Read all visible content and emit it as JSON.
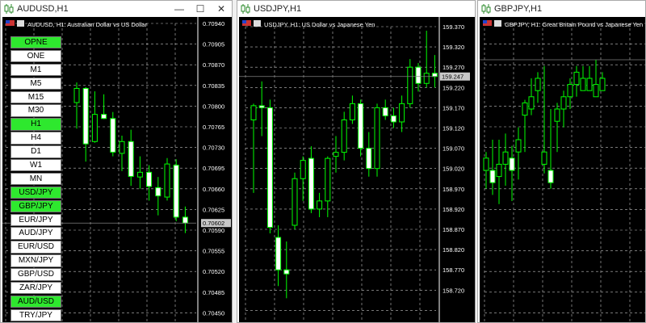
{
  "colors": {
    "grid": "#c0c0c0",
    "candle": "#00ff00",
    "axis_text": "#ffffff",
    "chart_bg": "#000000",
    "active_button": "#2ee82e",
    "price_line": "#808080"
  },
  "windows": [
    {
      "title": "AUDUSD,H1",
      "info": "AUDUSD, H1: Australian Dollar vs US Dollar",
      "controls": {
        "minimize": "—",
        "maximize": "☐",
        "close": "✕"
      },
      "current_price": "0.70602",
      "price_labels": [
        "0.70940",
        "0.70905",
        "0.70870",
        "0.70835",
        "0.70800",
        "0.70765",
        "0.70730",
        "0.70695",
        "0.70660",
        "0.70625",
        "0.70590",
        "0.70555",
        "0.70520",
        "0.70485",
        "0.70450"
      ],
      "buttons": [
        {
          "label": "OPNE",
          "active": true
        },
        {
          "label": "ONE",
          "active": false
        },
        {
          "label": "M1",
          "active": false
        },
        {
          "label": "M5",
          "active": false
        },
        {
          "label": "M15",
          "active": false
        },
        {
          "label": "M30",
          "active": false
        },
        {
          "label": "H1",
          "active": true
        },
        {
          "label": "H4",
          "active": false
        },
        {
          "label": "D1",
          "active": false
        },
        {
          "label": "W1",
          "active": false
        },
        {
          "label": "MN",
          "active": false
        },
        {
          "label": "USD/JPY",
          "active": true
        },
        {
          "label": "GBP/JPY",
          "active": true
        },
        {
          "label": "EUR/JPY",
          "active": false
        },
        {
          "label": "AUD/JPY",
          "active": false
        },
        {
          "label": "EUR/USD",
          "active": false
        },
        {
          "label": "MXN/JPY",
          "active": false
        },
        {
          "label": "GBP/USD",
          "active": false
        },
        {
          "label": "ZAR/JPY",
          "active": false
        },
        {
          "label": "AUD/USD",
          "active": true
        },
        {
          "label": "TRY/JPY",
          "active": false
        }
      ],
      "candles": [
        [
          0.70806,
          0.7084,
          0.70762,
          0.7083
        ],
        [
          0.7083,
          0.70832,
          0.70706,
          0.70736
        ],
        [
          0.7074,
          0.70825,
          0.70738,
          0.70786
        ],
        [
          0.70786,
          0.7082,
          0.70778,
          0.70779
        ],
        [
          0.70779,
          0.7079,
          0.70715,
          0.70722
        ],
        [
          0.7072,
          0.7075,
          0.7069,
          0.7074
        ],
        [
          0.7074,
          0.7076,
          0.70665,
          0.70681
        ],
        [
          0.7068,
          0.70715,
          0.7066,
          0.70688
        ],
        [
          0.70688,
          0.707,
          0.7064,
          0.70664
        ],
        [
          0.70662,
          0.7068,
          0.70615,
          0.70648
        ],
        [
          0.70646,
          0.70712,
          0.7064,
          0.70702
        ],
        [
          0.707,
          0.7071,
          0.70605,
          0.70612
        ],
        [
          0.70612,
          0.7063,
          0.70585,
          0.70602
        ]
      ]
    },
    {
      "title": "USDJPY,H1",
      "info": "USDJPY, H1: US Dollar vs Japanese Yen",
      "controls": {
        "minimize": "—",
        "maximize": "☐",
        "close": "✕"
      },
      "current_price": "159.247",
      "price_labels": [
        "159.370",
        "159.320",
        "159.270",
        "159.220",
        "159.170",
        "159.120",
        "159.070",
        "159.020",
        "158.970",
        "158.920",
        "158.870",
        "158.820",
        "158.770",
        "158.720"
      ],
      "candles": [
        [
          159.14,
          159.18,
          158.96,
          159.175
        ],
        [
          159.175,
          159.235,
          159.1,
          159.17
        ],
        [
          159.17,
          159.19,
          158.86,
          158.875
        ],
        [
          158.85,
          158.88,
          158.73,
          158.77
        ],
        [
          158.77,
          158.84,
          158.7,
          158.76
        ],
        [
          158.88,
          159.01,
          158.87,
          158.995
        ],
        [
          158.995,
          159.05,
          158.94,
          159.04
        ],
        [
          159.045,
          159.075,
          158.91,
          158.92
        ],
        [
          158.92,
          158.96,
          158.9,
          158.94
        ],
        [
          158.94,
          159.05,
          158.9,
          159.045
        ],
        [
          159.05,
          159.1,
          159.01,
          159.06
        ],
        [
          159.06,
          159.16,
          159.04,
          159.14
        ],
        [
          159.14,
          159.2,
          159.13,
          159.18
        ],
        [
          159.18,
          159.19,
          159.05,
          159.07
        ],
        [
          159.07,
          159.11,
          159.0,
          159.02
        ],
        [
          159.02,
          159.18,
          159.0,
          159.17
        ],
        [
          159.17,
          159.19,
          159.14,
          159.15
        ],
        [
          159.15,
          159.17,
          159.12,
          159.135
        ],
        [
          159.135,
          159.2,
          159.11,
          159.18
        ],
        [
          159.18,
          159.29,
          159.17,
          159.27
        ],
        [
          159.27,
          159.28,
          159.21,
          159.23
        ],
        [
          159.23,
          159.36,
          159.22,
          159.255
        ],
        [
          159.255,
          159.3,
          159.22,
          159.247
        ]
      ]
    },
    {
      "title": "GBPJPY,H1",
      "info": "GBPJPY, H1: Great Britain Pound vs Japanese Yen",
      "controls": {
        "minimize": "—",
        "maximize": "☐",
        "close": "✕"
      },
      "candles": [
        [
          8,
          0.56,
          0.44,
          0.54
        ],
        [
          16,
          0.6,
          0.42,
          0.46
        ],
        [
          24,
          0.6,
          0.39,
          0.52
        ],
        [
          32,
          0.62,
          0.45,
          0.56
        ],
        [
          40,
          0.58,
          0.4,
          0.5
        ],
        [
          48,
          0.64,
          0.47,
          0.6
        ],
        [
          56,
          0.73,
          0.56,
          0.72
        ],
        [
          64,
          0.8,
          0.68,
          0.74
        ],
        [
          72,
          0.82,
          0.72,
          0.8
        ],
        [
          80,
          0.84,
          0.49,
          0.56
        ],
        [
          88,
          0.7,
          0.44,
          0.46
        ],
        [
          96,
          0.72,
          0.56,
          0.7
        ],
        [
          104,
          0.76,
          0.64,
          0.74
        ],
        [
          112,
          0.8,
          0.7,
          0.78
        ],
        [
          120,
          0.84,
          0.74,
          0.82
        ],
        [
          128,
          0.84,
          0.76,
          0.8
        ],
        [
          136,
          0.84,
          0.78,
          0.8
        ],
        [
          144,
          0.86,
          0.74,
          0.78
        ],
        [
          152,
          0.82,
          0.76,
          0.8
        ]
      ]
    }
  ]
}
